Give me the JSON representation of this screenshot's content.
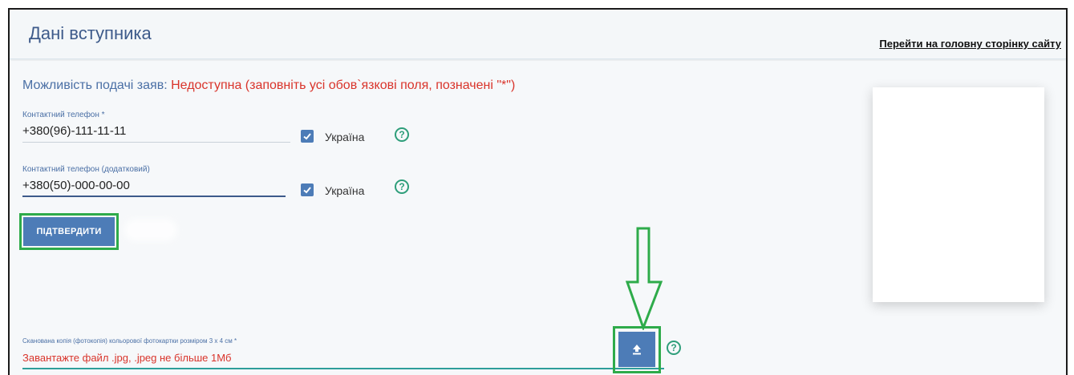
{
  "header": {
    "title": "Дані вступника",
    "home_link": "Перейти на головну сторінку сайту"
  },
  "availability": {
    "label": "Можливість подачі заяв:",
    "value": "Недоступна (заповніть усі обов`язкові поля, позначені \"*\")"
  },
  "phone": {
    "label": "Контактний телефон *",
    "value": "+380(96)-111-11-11",
    "country_label": "Україна",
    "country_checked": true
  },
  "phone_extra": {
    "label": "Контактний телефон (додатковий)",
    "value": "+380(50)-000-00-00",
    "country_label": "Україна",
    "country_checked": true
  },
  "help_glyph": "?",
  "confirm_button": "ПІДТВЕРДИТИ",
  "photo_upload": {
    "label": "Сканована копія (фотокопія) кольорової фотокартки розміром 3 х 4 см *",
    "hint": "Завантажте файл .jpg, .jpeg не більше 1Мб"
  },
  "colors": {
    "accent": "#4d7cb7",
    "error": "#d9342b",
    "highlight": "#2eab4a",
    "help": "#2e9e7a"
  },
  "icons": [
    "check-icon",
    "help-icon",
    "upload-icon",
    "down-arrow-annotation"
  ]
}
